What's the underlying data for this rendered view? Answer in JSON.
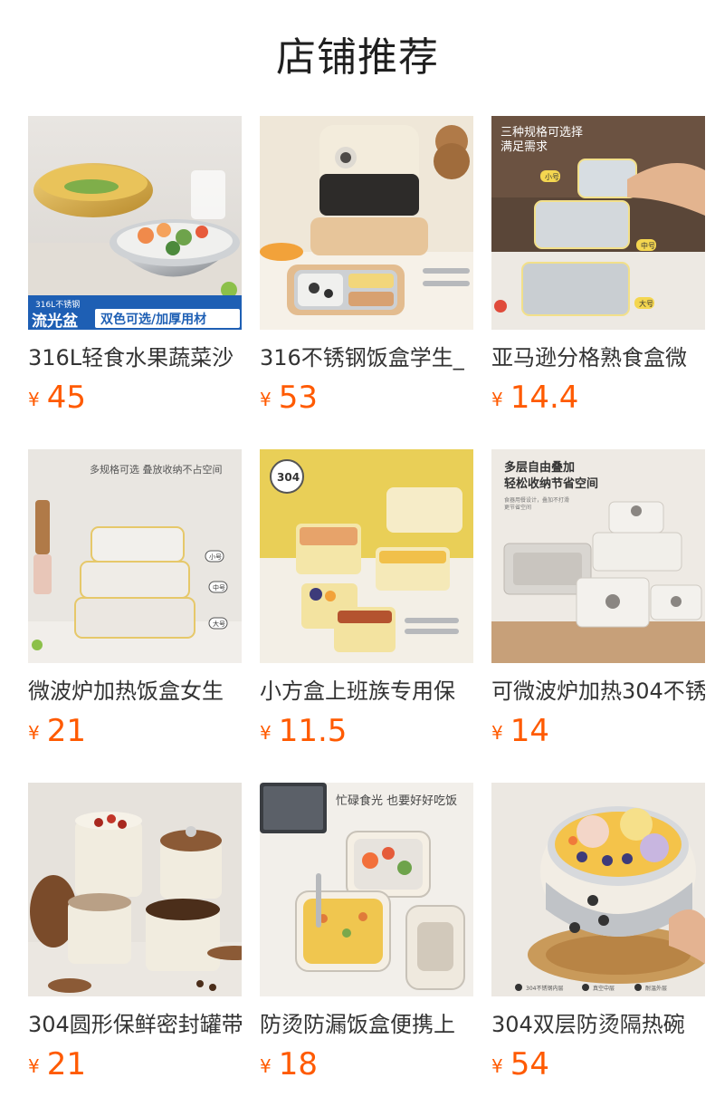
{
  "title": "店铺推荐",
  "colors": {
    "price": "#ff5a00",
    "text": "#333333",
    "title": "#1f1f1f"
  },
  "products": [
    {
      "name": "316L轻食水果蔬菜沙",
      "currency": "¥",
      "price": "45",
      "image": {
        "subject": "stainless steel salad bowls",
        "badge_small": "316L不锈钢",
        "badge_big": "流光盆",
        "tagline": "双色可选/加厚用材"
      }
    },
    {
      "name": "316不锈钢饭盒学生_",
      "currency": "¥",
      "price": "53",
      "image": {
        "subject": "cream lunch box set"
      }
    },
    {
      "name": "亚马逊分格熟食盒微",
      "currency": "¥",
      "price": "14.4",
      "image": {
        "subject": "three-size food containers",
        "headline": "三种规格可选择",
        "subline": "满足需求",
        "sizes": [
          "小号",
          "中号",
          "大号"
        ]
      }
    },
    {
      "name": "微波炉加热饭盒女生",
      "currency": "¥",
      "price": "21",
      "image": {
        "subject": "stacked divided containers",
        "headline": "多规格可选 叠放收纳不占空间",
        "sizes": [
          "小号",
          "中号",
          "大号"
        ]
      }
    },
    {
      "name": "小方盒上班族专用保",
      "currency": "¥",
      "price": "11.5",
      "image": {
        "subject": "yellow square lunch boxes",
        "badge": "304"
      }
    },
    {
      "name": "可微波炉加热304不锈",
      "currency": "¥",
      "price": "14",
      "image": {
        "subject": "stackable storage containers",
        "headline": "多层自由叠加",
        "subline": "轻松收纳节省空间"
      }
    },
    {
      "name": "304圆形保鲜密封罐带",
      "currency": "¥",
      "price": "21",
      "image": {
        "subject": "round sealed canisters with wooden lids"
      }
    },
    {
      "name": "防烫防漏饭盒便携上",
      "currency": "¥",
      "price": "18",
      "image": {
        "subject": "portable lunch box with food",
        "headline": "忙碌食光 也要好好吃饭"
      }
    },
    {
      "name": "304双层防烫隔热碗",
      "currency": "¥",
      "price": "54",
      "image": {
        "subject": "double-layer insulated bowl with ice cream",
        "legend": [
          "304不锈钢内层",
          "真空中层",
          "耐温外层"
        ]
      }
    }
  ]
}
